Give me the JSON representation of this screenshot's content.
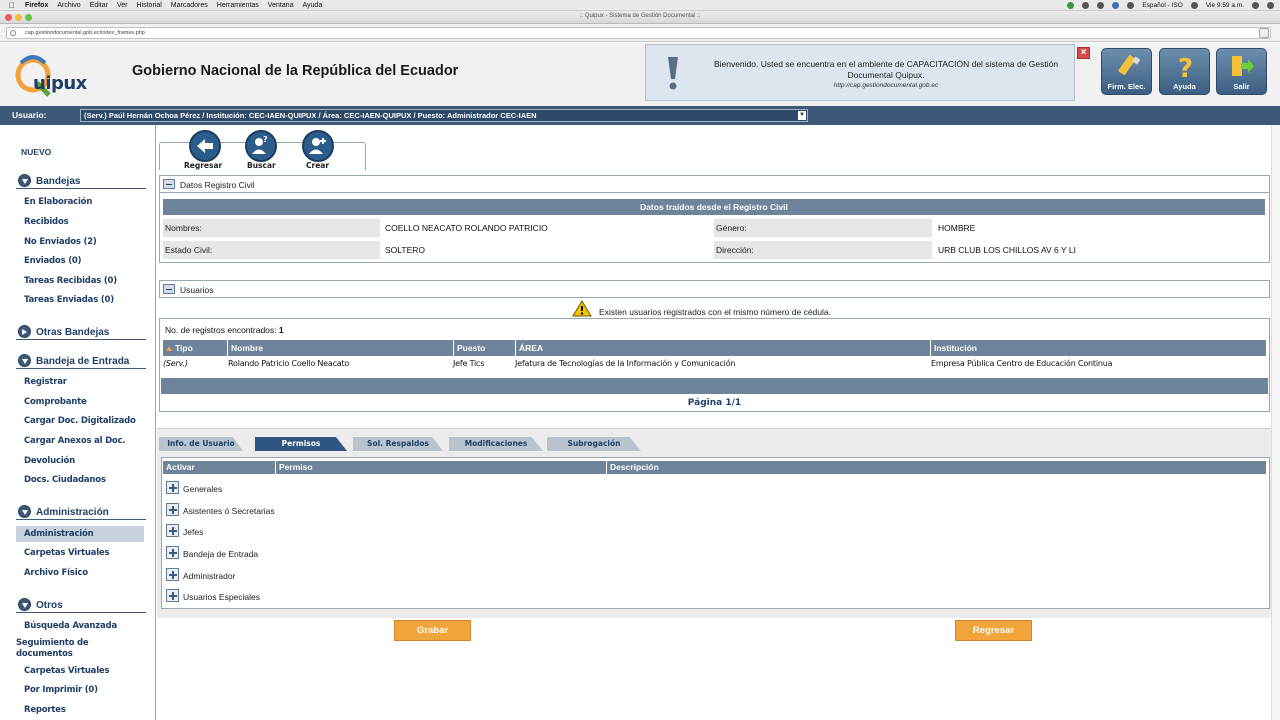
{
  "system_menubar": {
    "app": "Firefox",
    "items": [
      "Archivo",
      "Editar",
      "Ver",
      "Historial",
      "Marcadores",
      "Herramientas",
      "Ventana",
      "Ayuda"
    ],
    "input_source": "Español - ISO",
    "clock": "Vie 9:59 a.m."
  },
  "browser": {
    "window_title": ":: Quipux - Sistema de Gestión Documental ::",
    "url": "cap.gestiondocumental.gob.ec/index_frames.php"
  },
  "header": {
    "logo_text": "uipux",
    "title": "Gobierno Nacional de la República del Ecuador",
    "notice": {
      "message": "Bienvenido. Usted se encuentra en el ambiente de CAPACITACIÓN del sistema de Gestión Documental Quipux.",
      "url": "http://cap.gestiondocumental.gob.ec"
    },
    "buttons": [
      {
        "label": "Firm. Elec.",
        "icon": "usb-key-icon"
      },
      {
        "label": "Ayuda",
        "icon": "question-icon"
      },
      {
        "label": "Salir",
        "icon": "exit-door-icon"
      }
    ]
  },
  "userbar": {
    "label": "Usuario:",
    "selected": "(Serv.) Paúl Hernán Ochoa Pérez / Institución: CEC-IAEN-QUIPUX / Área: CEC-IAEN-QUIPUX / Puesto: Administrador CEC-IAEN"
  },
  "sidebar": {
    "nuevo": "NUEVO",
    "sections": {
      "bandejas": {
        "title": "Bandejas",
        "items": [
          "En Elaboración",
          "Recibidos",
          "No Enviados (2)",
          "Enviados (0)",
          "Tareas Recibidas (0)",
          "Tareas Enviadas (0)"
        ]
      },
      "otras": {
        "title": "Otras Bandejas"
      },
      "entrada": {
        "title": "Bandeja de Entrada",
        "items": [
          "Registrar",
          "Comprobante",
          "Cargar Doc. Digitalizado",
          "Cargar Anexos al Doc.",
          "Devolución",
          "Docs. Ciudadanos"
        ]
      },
      "admin": {
        "title": "Administración",
        "items": [
          "Administración",
          "Carpetas Virtuales",
          "Archivo Físico"
        ]
      },
      "otros": {
        "title": "Otros",
        "items": [
          "Búsqueda Avanzada",
          "Seguimiento de documentos",
          "Carpetas Virtuales",
          "Por Imprimir (0)",
          "Reportes"
        ]
      }
    }
  },
  "toolbar": {
    "buttons": [
      {
        "label": "Regresar",
        "icon": "back-arrow-icon"
      },
      {
        "label": "Buscar",
        "icon": "search-user-icon"
      },
      {
        "label": "Crear",
        "icon": "add-user-icon"
      }
    ]
  },
  "registro_civil": {
    "panel_title": "Datos Registro Civil",
    "bar_title": "Datos traídos desde el Registro Civil",
    "fields": {
      "nombres_label": "Nombres:",
      "nombres_value": "COELLO NEACATO ROLANDO PATRICIO",
      "genero_label": "Género:",
      "genero_value": "HOMBRE",
      "estado_label": "Estado Civil:",
      "estado_value": "SOLTERO",
      "direccion_label": "Dirección:",
      "direccion_value": "URB CLUB LOS CHILLOS AV 6 Y LI"
    }
  },
  "usuarios": {
    "panel_title": "Usuarios",
    "warning": "Existen usuarios registrados con el mismo número de cédula.",
    "count_label": "No. de registros encontrados:",
    "count_value": "1",
    "columns": [
      "Tipo",
      "Nombre",
      "Puesto",
      "ÁREA",
      "Institución"
    ],
    "rows": [
      [
        "(Serv.)",
        "Rolando Patricio Coello Neacato",
        "Jefe Tics",
        "Jefatura de Tecnologías de la Información y Comunicación",
        "Empresa Pública Centro de Educación Continua"
      ]
    ],
    "pagination": "Página 1/1"
  },
  "tabs": [
    "Info. de Usuario",
    "Permisos",
    "Sol. Respaldos",
    "Modificaciones",
    "Subrogación"
  ],
  "active_tab": "Permisos",
  "permisos": {
    "columns": [
      "Activar",
      "Permiso",
      "Descripción"
    ],
    "groups": [
      "Generales",
      "Asistentes ó Secretarias",
      "Jefes",
      "Bandeja de Entrada",
      "Administrador",
      "Usuarios Especiales"
    ]
  },
  "actions": {
    "save": "Grabar",
    "back": "Regresar"
  },
  "colors": {
    "header_bar": "#3e5977",
    "accent_orange": "#f1a43a",
    "grid_bar": "#6f849a",
    "active_tab": "#2f5680"
  }
}
